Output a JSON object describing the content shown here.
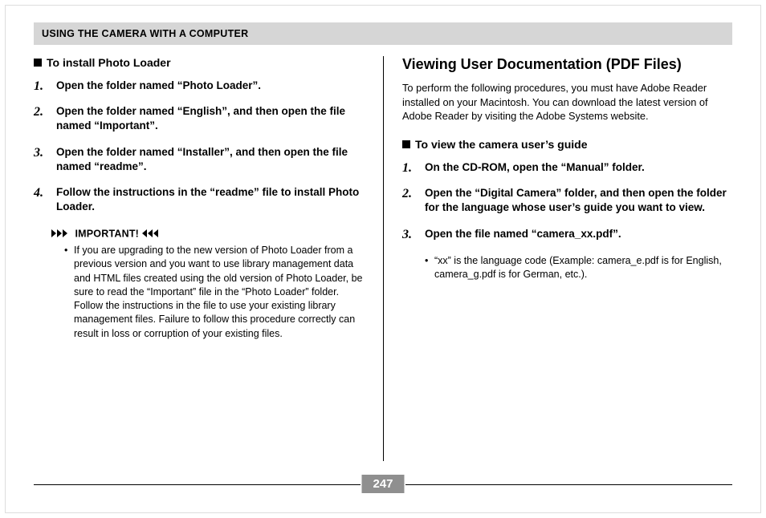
{
  "header": "USING THE CAMERA WITH A COMPUTER",
  "left": {
    "heading": "To install Photo Loader",
    "steps": [
      "Open the folder named “Photo Loader”.",
      "Open the folder named “English”, and then open the file named “Important”.",
      "Open the folder named “Installer”, and then open the file named “readme”.",
      "Follow the instructions in the “readme” file to install Photo Loader."
    ],
    "important_label": "IMPORTANT!",
    "important_bullet": "If you are upgrading to the new version of Photo Loader from a previous version and you want to use library management data and HTML files created using the old version of Photo Loader, be sure to read the “Important” file in the “Photo Loader” folder. Follow the instructions in the file to use your existing library management files. Failure to follow this procedure correctly can result in loss or corruption of your existing files."
  },
  "right": {
    "title": "Viewing User Documentation (PDF Files)",
    "intro": "To perform the following procedures, you must have Adobe Reader installed on your Macintosh. You can download the latest version of Adobe Reader by visiting the Adobe Systems website.",
    "heading": "To view the camera user’s guide",
    "steps": [
      "On the CD-ROM, open the “Manual” folder.",
      "Open the  “Digital Camera” folder, and then open the folder for the language whose user’s guide you want to view.",
      "Open the file named “camera_xx.pdf”."
    ],
    "note": "“xx” is the language code (Example: camera_e.pdf is for English, camera_g.pdf is for German, etc.)."
  },
  "page_number": "247"
}
